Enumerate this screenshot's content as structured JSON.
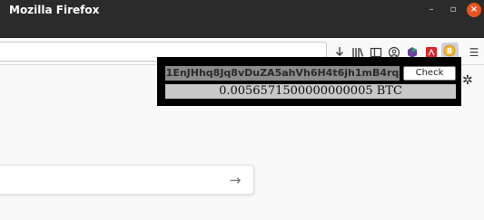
{
  "window": {
    "title": "Mozilla Firefox",
    "minimize_glyph": "–",
    "maximize_glyph": "▫",
    "close_glyph": "×"
  },
  "toolbar": {
    "icons": [
      "download-icon",
      "library-icon",
      "sidebar-icon",
      "account-icon",
      "extension-icon",
      "pdf-extension-icon",
      "bitcoin-extension-icon",
      "menu-icon"
    ],
    "menu_glyph": "☰"
  },
  "popup": {
    "address": "1EnJHhq8Jq8vDuZA5ahVh6H4t6jh1mB4rq",
    "check_label": "Check",
    "balance": "0.0056571500000000005 BTC"
  },
  "settings": {
    "gear_glyph": "✲"
  },
  "newtab": {
    "search_arrow_glyph": "→"
  },
  "colors": {
    "titlebar": "#2b2b2b",
    "close_button": "#e95420",
    "popup_background": "#000000",
    "address_background": "#8c8c8c",
    "balance_background": "#c8c8c8"
  }
}
